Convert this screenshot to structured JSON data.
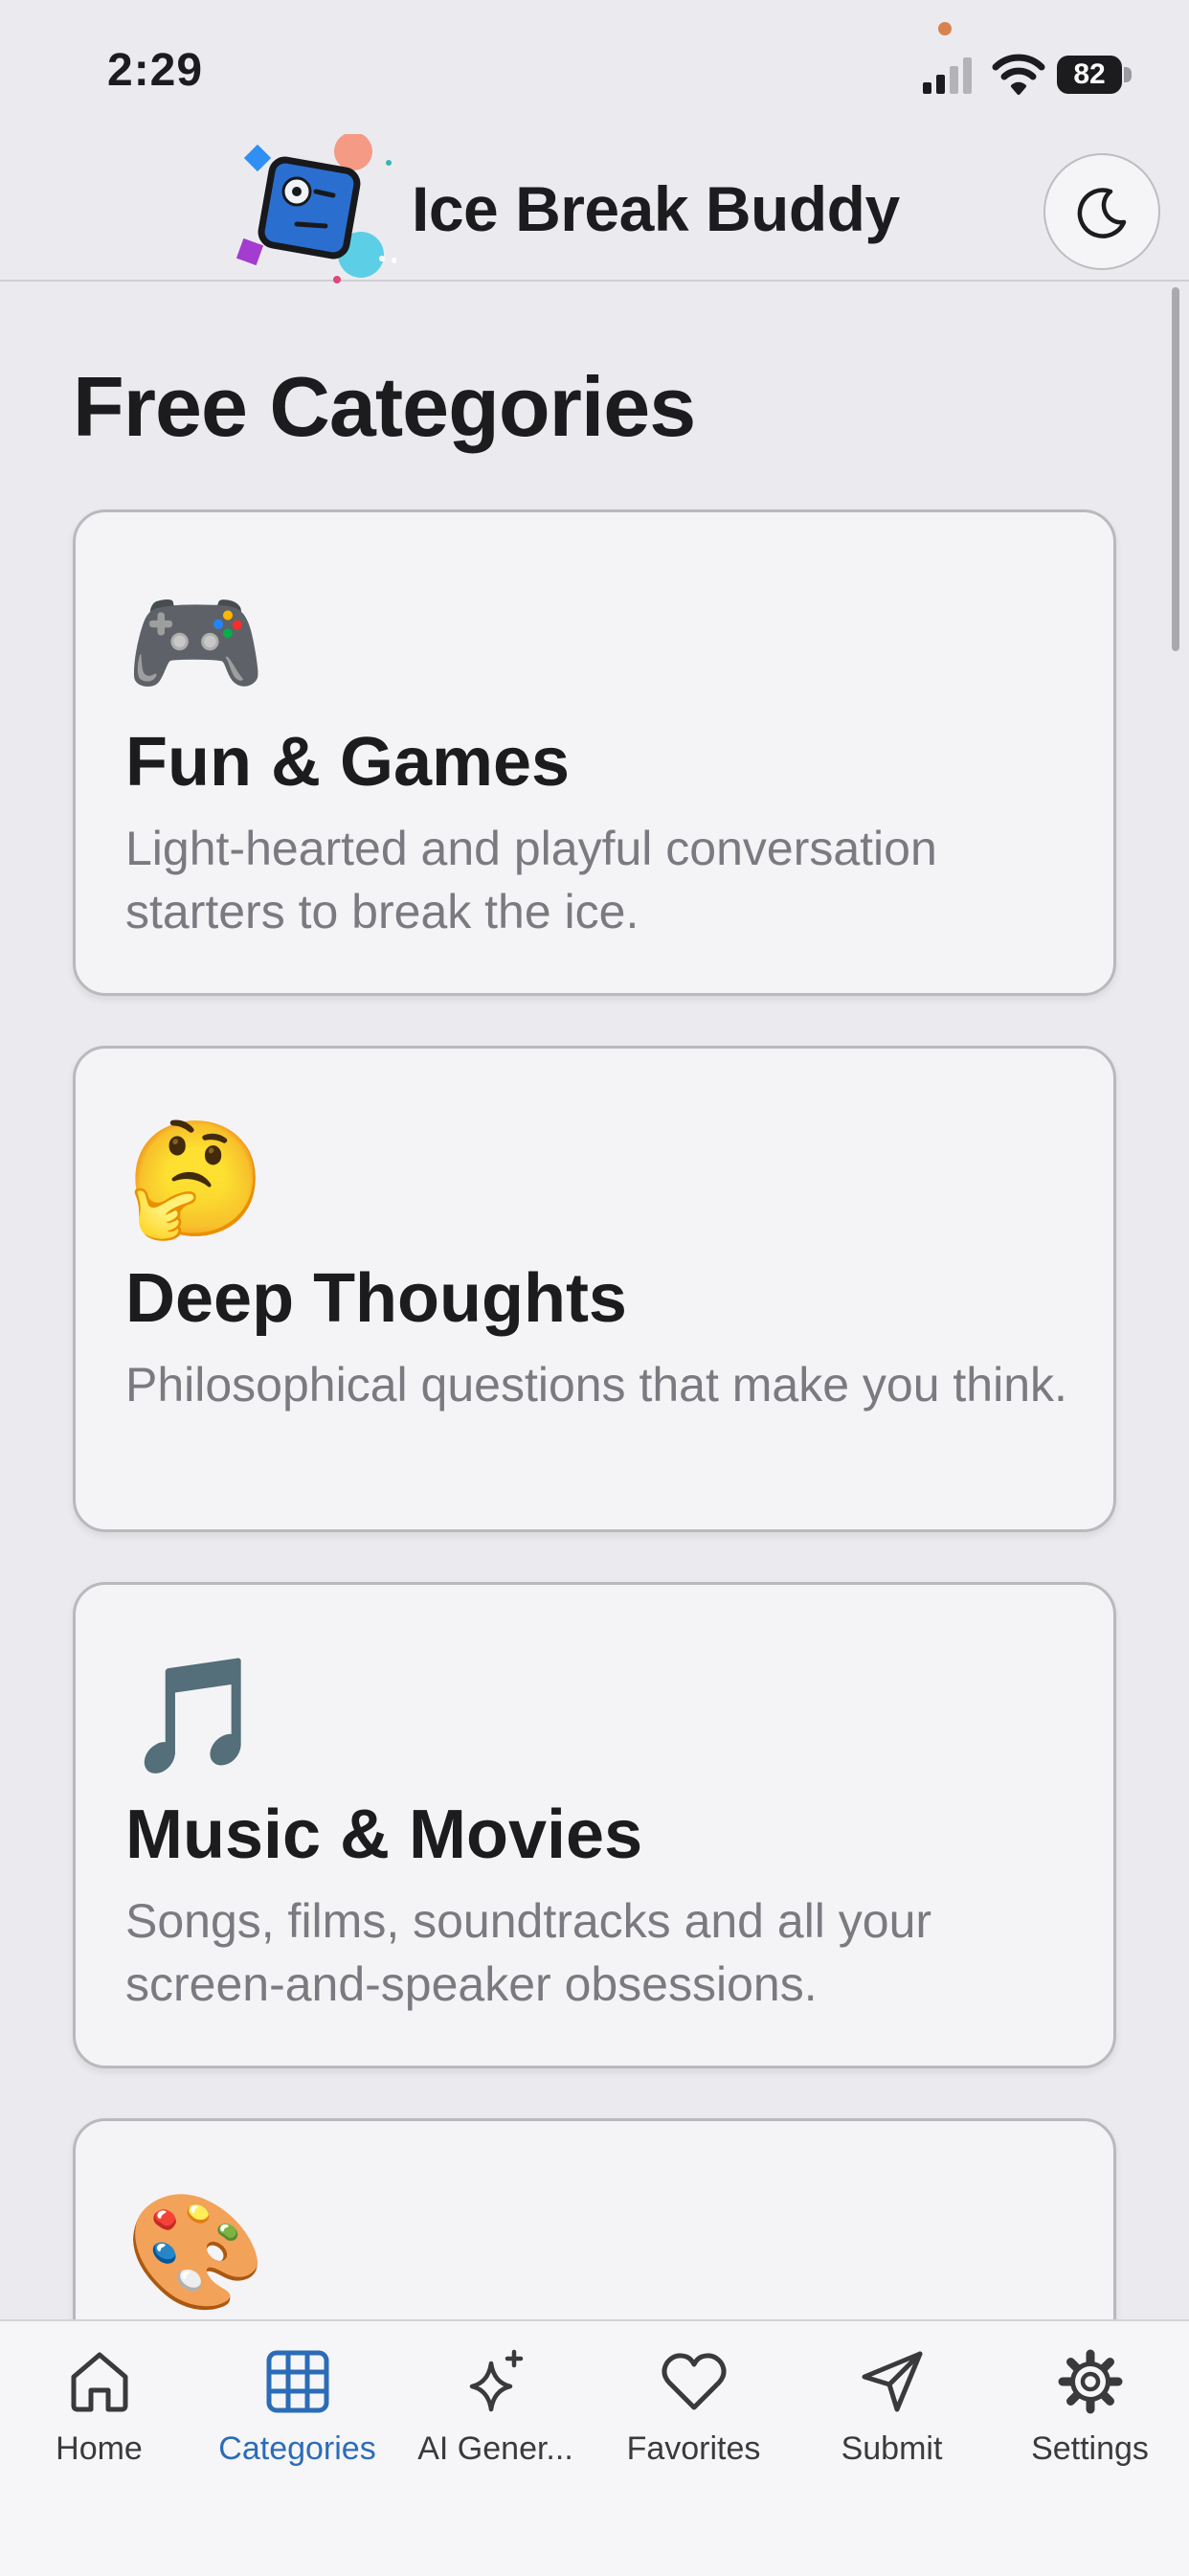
{
  "status_bar": {
    "time": "2:29",
    "battery": "82"
  },
  "header": {
    "title": "Ice Break Buddy",
    "theme_icon": "moon-icon"
  },
  "main": {
    "section_title": "Free Categories",
    "categories": [
      {
        "emoji": "🎮",
        "title": "Fun & Games",
        "description": "Light-hearted and playful conversation starters to break the ice."
      },
      {
        "emoji": "🤔",
        "title": "Deep Thoughts",
        "description": "Philosophical questions that make you think."
      },
      {
        "emoji": "🎵",
        "title": "Music & Movies",
        "description": "Songs, films, soundtracks and all your screen-and-speaker obsessions."
      },
      {
        "emoji": "🎨",
        "title": "",
        "description": ""
      }
    ]
  },
  "tab_bar": {
    "active": "Categories",
    "accent_color": "#2b6cb8",
    "tabs": [
      {
        "label": "Home",
        "icon": "home-icon"
      },
      {
        "label": "Categories",
        "icon": "grid-icon"
      },
      {
        "label": "AI Gener...",
        "icon": "sparkles-icon"
      },
      {
        "label": "Favorites",
        "icon": "heart-icon"
      },
      {
        "label": "Submit",
        "icon": "send-icon"
      },
      {
        "label": "Settings",
        "icon": "gear-icon"
      }
    ]
  }
}
